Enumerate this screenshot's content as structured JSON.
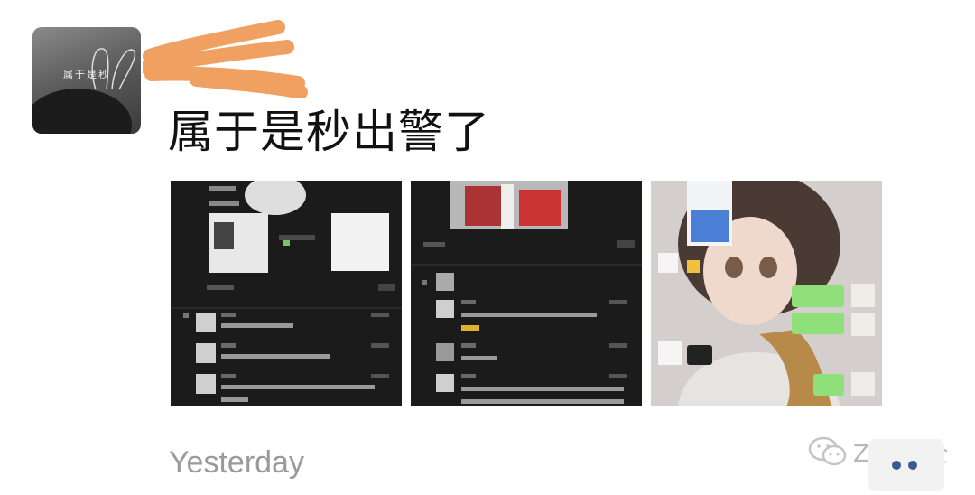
{
  "post": {
    "text": "属于是秒出警了",
    "time": "Yesterday",
    "avatar_label": "属于是秒"
  },
  "images": [
    {
      "label": "chat-screenshot-1"
    },
    {
      "label": "chat-screenshot-2"
    },
    {
      "label": "anime-girl-chat"
    }
  ],
  "watermark": {
    "text": "ZAC安全"
  },
  "icons": {
    "wechat": "wechat-icon",
    "more": "more-icon"
  },
  "colors": {
    "scribble": "#f0a060",
    "link": "#3a5a94",
    "text": "#111111",
    "meta": "#9a9a9a"
  }
}
